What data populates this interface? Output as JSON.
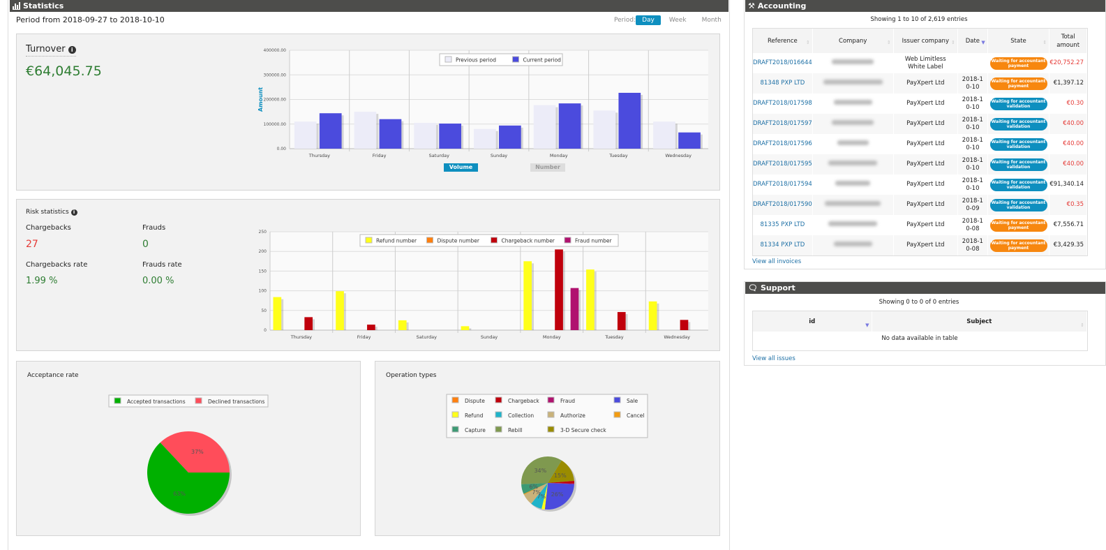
{
  "statistics": {
    "title": "Statistics",
    "period_text": "Period from 2018-09-27 to 2018-10-10",
    "period_label": "Period:",
    "periods": [
      "Day",
      "Week",
      "Month"
    ],
    "active_period": "Day"
  },
  "turnover": {
    "title": "Turnover",
    "value": "€64,045.75",
    "toggle": [
      "Volume",
      "Number"
    ],
    "active_toggle": "Volume"
  },
  "risk": {
    "title": "Risk statistics",
    "chargebacks_label": "Chargebacks",
    "chargebacks": "27",
    "frauds_label": "Frauds",
    "frauds": "0",
    "chargebacks_rate_label": "Chargebacks rate",
    "chargebacks_rate": "1.99 %",
    "frauds_rate_label": "Frauds rate",
    "frauds_rate": "0.00 %"
  },
  "acceptance": {
    "title": "Acceptance rate"
  },
  "operations": {
    "title": "Operation types"
  },
  "chart_data": [
    {
      "type": "bar",
      "ylabel": "Amount",
      "ylim": [
        0,
        400000
      ],
      "yticks": [
        "0.00",
        "100000.00",
        "200000.00",
        "300000.00",
        "400000.00"
      ],
      "grid": true,
      "legend": "top-center",
      "categories": [
        "Thursday",
        "Friday",
        "Saturday",
        "Sunday",
        "Monday",
        "Tuesday",
        "Wednesday"
      ],
      "series": [
        {
          "name": "Previous period",
          "color": "#ececf8",
          "values": [
            110000,
            150000,
            105000,
            80000,
            177000,
            155000,
            110000
          ]
        },
        {
          "name": "Current period",
          "color": "#4b4bdd",
          "values": [
            144000,
            120000,
            102000,
            94000,
            184000,
            227000,
            66000
          ]
        }
      ]
    },
    {
      "type": "bar",
      "ylim": [
        0,
        250
      ],
      "yticks": [
        "0",
        "50",
        "100",
        "150",
        "200",
        "250"
      ],
      "grid": true,
      "legend": "top-center",
      "categories": [
        "Thursday",
        "Friday",
        "Saturday",
        "Sunday",
        "Monday",
        "Tuesday",
        "Wednesday"
      ],
      "series": [
        {
          "name": "Refund number",
          "color": "#ffff1a",
          "values": [
            84,
            99,
            25,
            10,
            175,
            154,
            73
          ]
        },
        {
          "name": "Dispute number",
          "color": "#ff7f0e",
          "values": [
            0,
            0,
            0,
            0,
            0,
            0,
            0
          ]
        },
        {
          "name": "Chargeback number",
          "color": "#c0000c",
          "values": [
            33,
            14,
            0,
            0,
            205,
            46,
            26
          ]
        },
        {
          "name": "Fraud number",
          "color": "#b0126f",
          "values": [
            0,
            0,
            0,
            0,
            107,
            0,
            0
          ]
        }
      ]
    },
    {
      "type": "pie",
      "legend": "top",
      "slices": [
        {
          "name": "Accepted transactions",
          "color": "#00b000",
          "value": 63,
          "label": "63%"
        },
        {
          "name": "Declined transactions",
          "color": "#ff4d5a",
          "value": 37,
          "label": "37%"
        }
      ]
    },
    {
      "type": "pie",
      "legend": "top",
      "legend_order": [
        "Dispute",
        "Chargeback",
        "Fraud",
        "Sale",
        "Refund",
        "Collection",
        "Authorize",
        "Cancel",
        "Capture",
        "Rebill",
        "3-D Secure check"
      ],
      "slices": [
        {
          "name": "3-D Secure check",
          "color": "#9a8c00",
          "value": 15,
          "label": "15%"
        },
        {
          "name": "Chargeback",
          "color": "#c0000c",
          "value": 1.5,
          "label": ""
        },
        {
          "name": "Fraud",
          "color": "#b0126f",
          "value": 0.5,
          "label": ""
        },
        {
          "name": "Sale",
          "color": "#4b4bdd",
          "value": 26,
          "label": "26%"
        },
        {
          "name": "Refund",
          "color": "#ffff1a",
          "value": 2,
          "label": ""
        },
        {
          "name": "Collection",
          "color": "#1fb3c9",
          "value": 7,
          "label": "7%"
        },
        {
          "name": "Authorize",
          "color": "#c9b27a",
          "value": 7,
          "label": "7%"
        },
        {
          "name": "Cancel",
          "color": "#f39c12",
          "value": 0.5,
          "label": ""
        },
        {
          "name": "Capture",
          "color": "#3d9a74",
          "value": 6,
          "label": "6%"
        },
        {
          "name": "Rebill",
          "color": "#7f994f",
          "value": 34.5,
          "label": "34%"
        },
        {
          "name": "Dispute",
          "color": "#ff7f0e",
          "value": 0,
          "label": ""
        }
      ]
    }
  ],
  "accounting": {
    "title": "Accounting",
    "showing": "Showing 1 to 10 of 2,619 entries",
    "columns": [
      "Reference",
      "Company",
      "Issuer company",
      "Date",
      "State",
      "Total amount"
    ],
    "rows": [
      {
        "ref": "DRAFT2018/016644",
        "issuer": "Web Limitless White Label",
        "date": "",
        "state": "Waiting for accountant payment",
        "state_color": "#f7870f",
        "total": "€20,752.27",
        "neg": true
      },
      {
        "ref": "81348 PXP LTD",
        "issuer": "PayXpert Ltd",
        "date": "2018-10-10",
        "state": "Waiting for accountant payment",
        "state_color": "#f7870f",
        "total": "€1,397.12",
        "neg": false
      },
      {
        "ref": "DRAFT2018/017598",
        "issuer": "PayXpert Ltd",
        "date": "2018-10-10",
        "state": "Waiting for accountant validation",
        "state_color": "#0e8fbf",
        "total": "€0.30",
        "neg": true
      },
      {
        "ref": "DRAFT2018/017597",
        "issuer": "PayXpert Ltd",
        "date": "2018-10-10",
        "state": "Waiting for accountant validation",
        "state_color": "#0e8fbf",
        "total": "€40.00",
        "neg": true
      },
      {
        "ref": "DRAFT2018/017596",
        "issuer": "PayXpert Ltd",
        "date": "2018-10-10",
        "state": "Waiting for accountant validation",
        "state_color": "#0e8fbf",
        "total": "€40.00",
        "neg": true
      },
      {
        "ref": "DRAFT2018/017595",
        "issuer": "PayXpert Ltd",
        "date": "2018-10-10",
        "state": "Waiting for accountant validation",
        "state_color": "#0e8fbf",
        "total": "€40.00",
        "neg": true
      },
      {
        "ref": "DRAFT2018/017594",
        "issuer": "PayXpert Ltd",
        "date": "2018-10-10",
        "state": "Waiting for accountant validation",
        "state_color": "#0e8fbf",
        "total": "€91,340.14",
        "neg": false
      },
      {
        "ref": "DRAFT2018/017590",
        "issuer": "PayXpert Ltd",
        "date": "2018-10-09",
        "state": "Waiting for accountant validation",
        "state_color": "#0e8fbf",
        "total": "€0.35",
        "neg": true
      },
      {
        "ref": "81335 PXP LTD",
        "issuer": "PayXpert Ltd",
        "date": "2018-10-08",
        "state": "Waiting for accountant payment",
        "state_color": "#f7870f",
        "total": "€7,556.71",
        "neg": false
      },
      {
        "ref": "81334 PXP LTD",
        "issuer": "PayXpert Ltd",
        "date": "2018-10-08",
        "state": "Waiting for accountant payment",
        "state_color": "#f7870f",
        "total": "€3,429.35",
        "neg": false
      }
    ],
    "view_all": "View all invoices"
  },
  "support": {
    "title": "Support",
    "showing": "Showing 0 to 0 of 0 entries",
    "columns": [
      "id",
      "Subject"
    ],
    "empty": "No data available in table",
    "view_all": "View all issues"
  }
}
